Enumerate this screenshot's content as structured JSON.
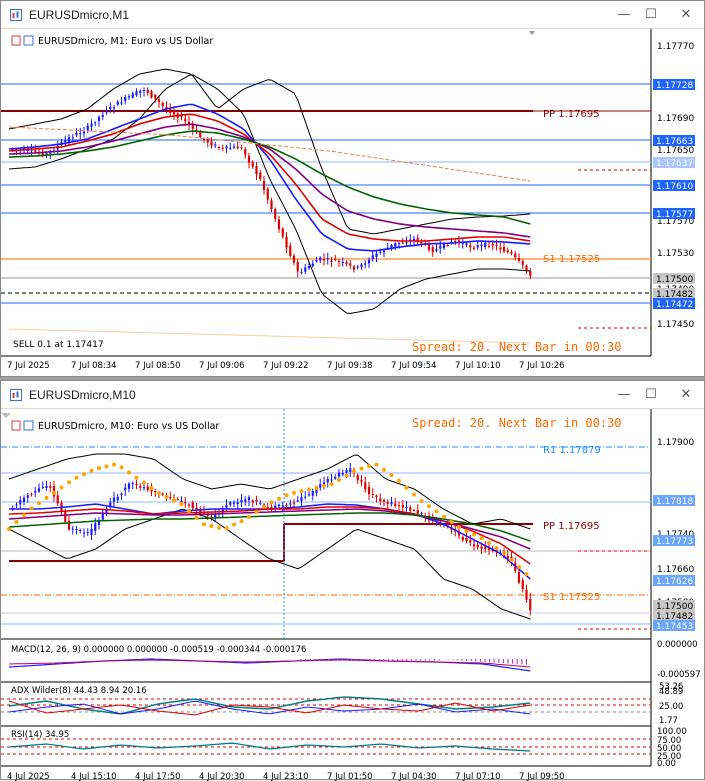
{
  "win1": {
    "title": "EURUSDmicro,M1",
    "header": "EURUSDmicro, M1:  Euro vs US Dollar",
    "spread": "Spread: 20. Next Bar in 00:30",
    "trade_note": "SELL 0.1 at 1.17417",
    "pp_label": "PP 1.17695",
    "s1_label": "S1 1.17525",
    "price_ticks": [
      "1.17770",
      "1.17690",
      "1.17650",
      "1.17570",
      "1.17530",
      "1.17490",
      "1.17450"
    ],
    "price_tags": [
      "1.17728",
      "1.17663",
      "1.17637",
      "1.17610",
      "1.17577",
      "1.17500",
      "1.17482",
      "1.17472"
    ],
    "time_labels": [
      "7 Jul 2025",
      "7 Jul 08:34",
      "7 Jul 08:50",
      "7 Jul 09:06",
      "7 Jul 09:22",
      "7 Jul 09:38",
      "7 Jul 09:54",
      "7 Jul 10:10",
      "7 Jul 10:26"
    ]
  },
  "win2": {
    "title": "EURUSDmicro,M10",
    "header": "EURUSDmicro, M10:  Euro vs US Dollar",
    "spread": "Spread: 20. Next Bar in 00:30",
    "r1_label": "R1 1.17879",
    "pp_label": "PP 1.17695",
    "s1_label": "S1 1.17525",
    "price_ticks": [
      "1.17900",
      "1.17740",
      "1.17660",
      "1.17580"
    ],
    "price_tags": [
      "1.17818",
      "1.17773",
      "1.17626",
      "1.17500",
      "1.17482",
      "1.17453"
    ],
    "macd_label": "MACD(12, 26, 9) 0.000000 0.000000 -0.000519 -0.000344 -0.000176",
    "macd_ticks": [
      "0.000000",
      "-0.000597"
    ],
    "adx_label": "ADX Wilder(8) 44.43 8.94 20.16",
    "adx_ticks": [
      "53.26",
      "48.89",
      "25.00",
      "1.77"
    ],
    "rsi_label": "RSI(14) 34.95",
    "rsi_ticks": [
      "100.00",
      "75.00",
      "50.00",
      "25.00",
      "0.00"
    ],
    "time_labels": [
      "4 Jul 2025",
      "4 Jul 15:10",
      "4 Jul 17:50",
      "4 Jul 20:30",
      "4 Jul 23:10",
      "7 Jul 01:50",
      "7 Jul 04:30",
      "7 Jul 07:10",
      "7 Jul 09:50"
    ]
  },
  "colors": {
    "bull": "#1a1aff",
    "bear": "#e00000",
    "pp": "#8b0000",
    "s1": "#ff6a00",
    "hline": "#1e64ff",
    "bands": "#000000",
    "ma_green": "#006400",
    "ma_purple": "#800080",
    "sar": "#ffa500"
  }
}
